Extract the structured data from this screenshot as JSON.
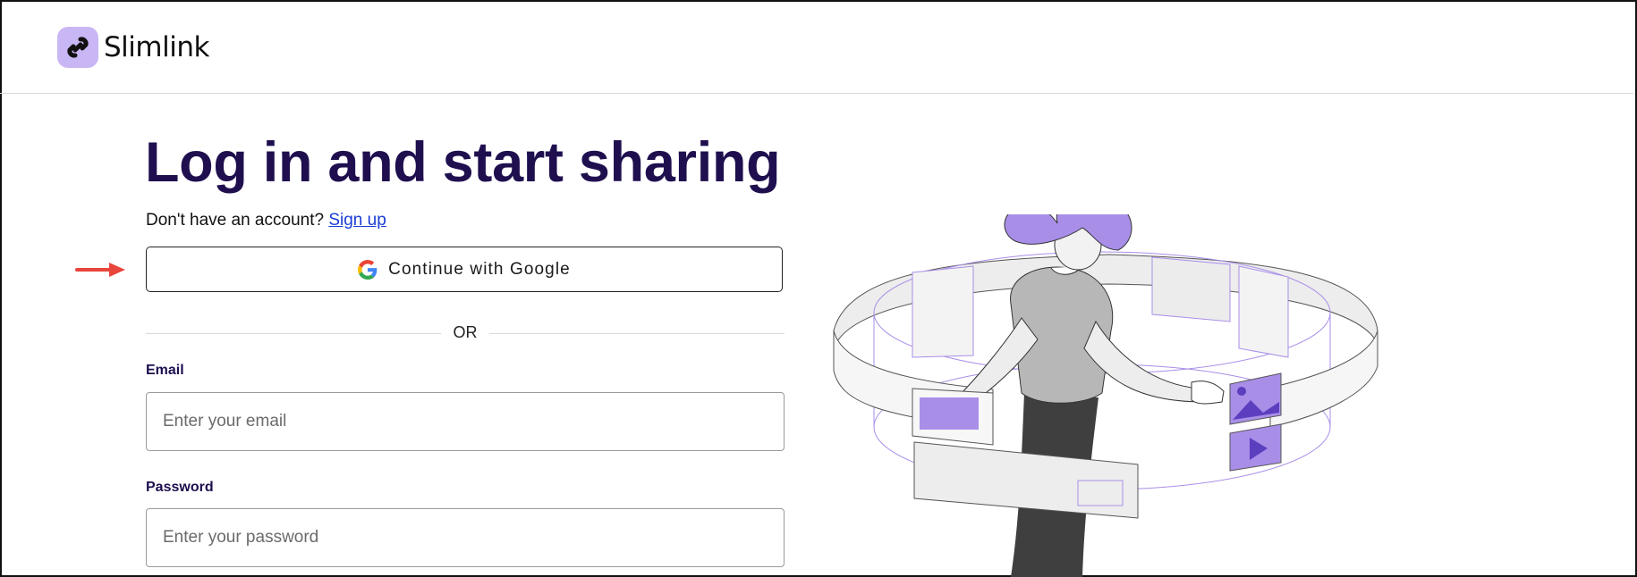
{
  "header": {
    "brand_name": "Slimlink",
    "logo_icon": "chain-link-icon"
  },
  "main": {
    "title": "Log in and start sharing",
    "signup_prompt": "Don't have an account?",
    "signup_link": "Sign up",
    "google_button_label": "Continue with Google",
    "google_icon": "google-g-icon",
    "divider_text": "OR",
    "email": {
      "label": "Email",
      "placeholder": "Enter your email",
      "value": ""
    },
    "password": {
      "label": "Password",
      "placeholder": "Enter your password",
      "value": ""
    }
  },
  "annotation": {
    "arrow_color": "#e8453c",
    "icon": "right-arrow-icon"
  },
  "colors": {
    "title": "#1f0f4f",
    "brand_accent": "#c9b6f4",
    "illustration_purple": "#a98ee8",
    "link": "#1a3cd6"
  }
}
